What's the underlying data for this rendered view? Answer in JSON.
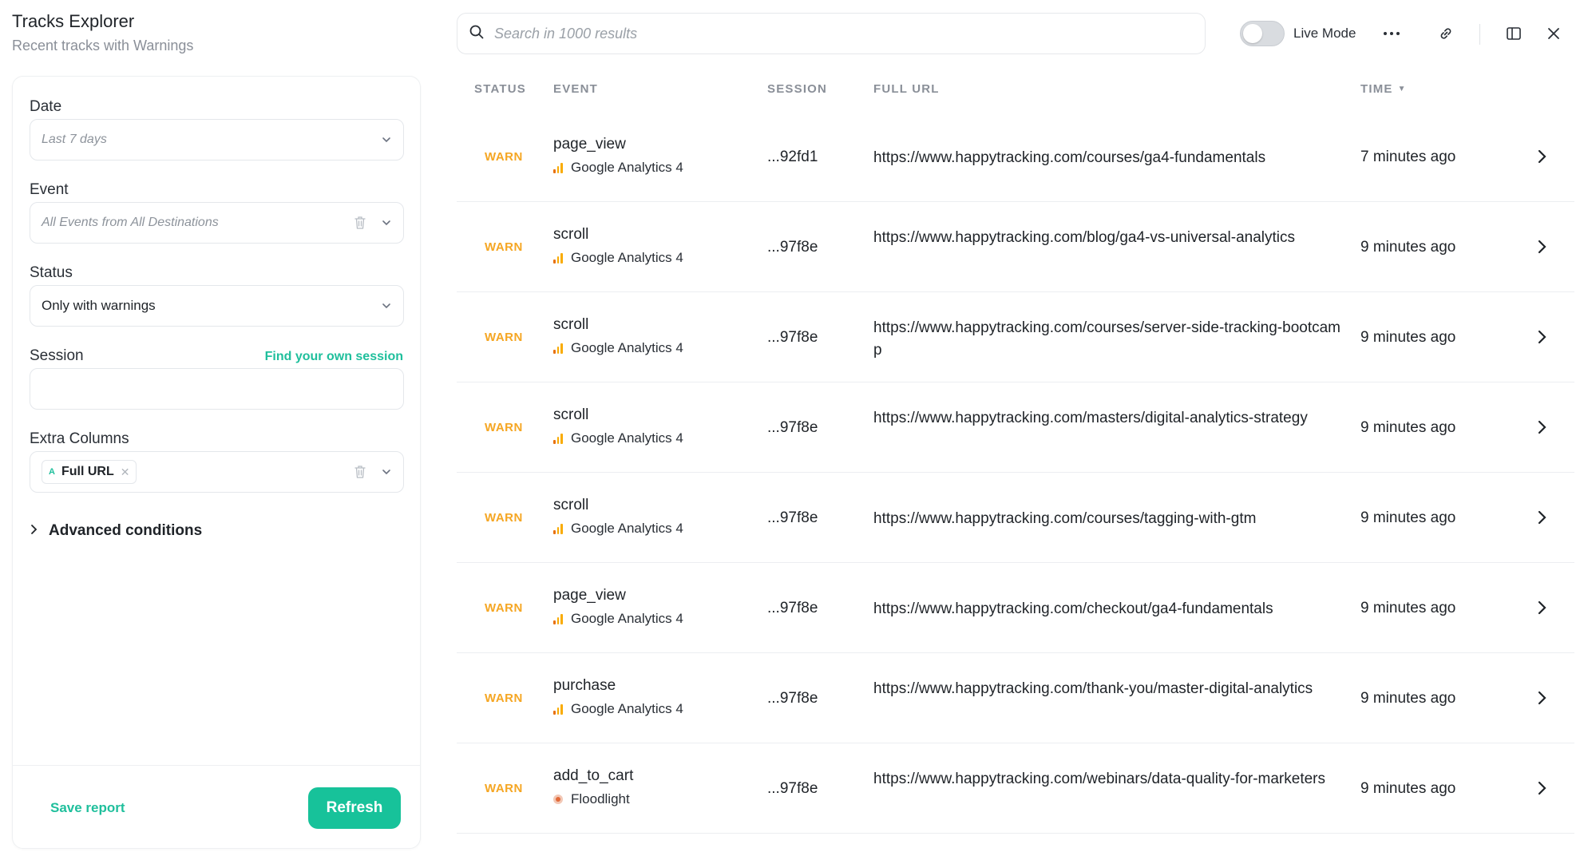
{
  "header": {
    "title": "Tracks Explorer",
    "subtitle": "Recent tracks with Warnings"
  },
  "filters": {
    "date": {
      "label": "Date",
      "placeholder": "Last 7 days"
    },
    "event": {
      "label": "Event",
      "placeholder": "All Events from All Destinations"
    },
    "status": {
      "label": "Status",
      "value": "Only with warnings"
    },
    "session": {
      "label": "Session",
      "link": "Find your own session",
      "value": ""
    },
    "extra_columns": {
      "label": "Extra Columns",
      "chip_icon": "A",
      "chip_label": "Full URL"
    },
    "advanced": "Advanced conditions",
    "save_report": "Save report",
    "refresh": "Refresh"
  },
  "toolbar": {
    "search_placeholder": "Search in 1000 results",
    "live_mode_label": "Live Mode",
    "live_mode_on": false
  },
  "table": {
    "columns": {
      "status": "STATUS",
      "event": "EVENT",
      "session": "SESSION",
      "full_url": "FULL URL",
      "time": "TIME"
    },
    "rows": [
      {
        "status": "WARN",
        "event": "page_view",
        "destination": "Google Analytics 4",
        "dest_icon": "ga4",
        "session": "...92fd1",
        "url": "https://www.happytracking.com/courses/ga4-fundamentals",
        "time": "7 minutes ago"
      },
      {
        "status": "WARN",
        "event": "scroll",
        "destination": "Google Analytics 4",
        "dest_icon": "ga4",
        "session": "...97f8e",
        "url": "https://www.happytracking.com/blog/ga4-vs-universal-analytics",
        "time": "9 minutes ago"
      },
      {
        "status": "WARN",
        "event": "scroll",
        "destination": "Google Analytics 4",
        "dest_icon": "ga4",
        "session": "...97f8e",
        "url": "https://www.happytracking.com/courses/server-side-tracking-bootcamp",
        "time": "9 minutes ago"
      },
      {
        "status": "WARN",
        "event": "scroll",
        "destination": "Google Analytics 4",
        "dest_icon": "ga4",
        "session": "...97f8e",
        "url": "https://www.happytracking.com/masters/digital-analytics-strategy",
        "time": "9 minutes ago"
      },
      {
        "status": "WARN",
        "event": "scroll",
        "destination": "Google Analytics 4",
        "dest_icon": "ga4",
        "session": "...97f8e",
        "url": "https://www.happytracking.com/courses/tagging-with-gtm",
        "time": "9 minutes ago"
      },
      {
        "status": "WARN",
        "event": "page_view",
        "destination": "Google Analytics 4",
        "dest_icon": "ga4",
        "session": "...97f8e",
        "url": "https://www.happytracking.com/checkout/ga4-fundamentals",
        "time": "9 minutes ago"
      },
      {
        "status": "WARN",
        "event": "purchase",
        "destination": "Google Analytics 4",
        "dest_icon": "ga4",
        "session": "...97f8e",
        "url": "https://www.happytracking.com/thank-you/master-digital-analytics",
        "time": "9 minutes ago"
      },
      {
        "status": "WARN",
        "event": "add_to_cart",
        "destination": "Floodlight",
        "dest_icon": "floodlight",
        "session": "...97f8e",
        "url": "https://www.happytracking.com/webinars/data-quality-for-marketers",
        "time": "9 minutes ago"
      }
    ]
  },
  "colors": {
    "accent": "#17c29a",
    "warn": "#f5a623"
  }
}
